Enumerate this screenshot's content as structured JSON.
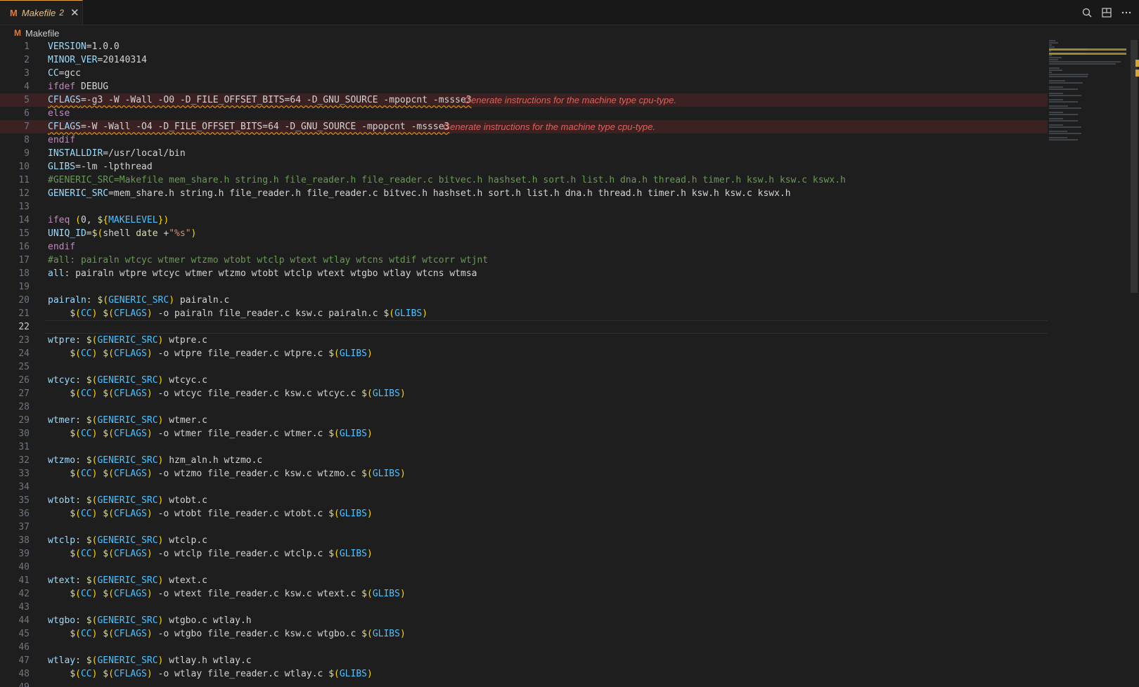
{
  "tab": {
    "icon": "M",
    "name": "Makefile",
    "problems": "2",
    "close_glyph": "✕"
  },
  "actions": [
    "search-icon",
    "split-editor-icon",
    "more-icon"
  ],
  "breadcrumb": {
    "icon": "M",
    "file": "Makefile"
  },
  "colors": {
    "keyword": "#c586c0",
    "variable": "#9cdcfe",
    "dollar": "#dcdcaa",
    "paren": "#ffd700",
    "comment": "#6a9955",
    "string": "#ce9178",
    "directive": "#c586c0",
    "error": "#e0625a",
    "active_tab_border": "#e2a33a"
  },
  "diagnostics": {
    "line5": "Generate instructions for the machine type cpu-type.",
    "line7": "Generate instructions for the machine type cpu-type."
  },
  "lines": [
    {
      "n": "1",
      "h": "<span class='v'>VERSION</span>=1.0.0"
    },
    {
      "n": "2",
      "h": "<span class='v'>MINOR_VER</span>=20140314"
    },
    {
      "n": "3",
      "h": "<span class='v'>CC</span>=gcc"
    },
    {
      "n": "4",
      "h": "<span class='k'>ifdef</span> DEBUG"
    },
    {
      "n": "5",
      "h": "<span class='v'>CFLAGS</span>=-g3 -W -Wall -O0 -D_FILE_OFFSET_BITS=64 -D_GNU_SOURCE -mpopcnt -mssse3",
      "err": "line5"
    },
    {
      "n": "6",
      "h": "<span class='k'>else</span>"
    },
    {
      "n": "7",
      "h": "<span class='v'>CFLAGS</span>=-W -Wall -O4 -D_FILE_OFFSET_BITS=64 -D_GNU_SOURCE -mpopcnt -mssse3",
      "err": "line7"
    },
    {
      "n": "8",
      "h": "<span class='k'>endif</span>"
    },
    {
      "n": "9",
      "h": "<span class='v'>INSTALLDIR</span>=/usr/local/bin"
    },
    {
      "n": "10",
      "h": "<span class='v'>GLIBS</span>=-lm -lpthread"
    },
    {
      "n": "11",
      "h": "<span class='c'>#GENERIC_SRC=Makefile mem_share.h string.h file_reader.h file_reader.c bitvec.h hashset.h sort.h list.h dna.h thread.h timer.h ksw.h ksw.c kswx.h</span>"
    },
    {
      "n": "12",
      "h": "<span class='v'>GENERIC_SRC</span>=mem_share.h string.h file_reader.h file_reader.c bitvec.h hashset.h sort.h list.h dna.h thread.h timer.h ksw.h ksw.c kswx.h"
    },
    {
      "n": "13",
      "h": ""
    },
    {
      "n": "14",
      "h": "<span class='k'>ifeq</span> <span class='p'>(</span>0, <span class='d'>$</span><span class='p'>{</span><span class='b'>MAKELEVEL</span><span class='p'>})</span>"
    },
    {
      "n": "15",
      "h": "<span class='v'>UNIQ_ID</span>=<span class='d'>$</span><span class='p'>(</span>shell <span class='y'>date</span> +<span class='s'>\"%s\"</span><span class='p'>)</span>"
    },
    {
      "n": "16",
      "h": "<span class='k'>endif</span>"
    },
    {
      "n": "17",
      "h": "<span class='c'>#all: pairaln wtcyc wtmer wtzmo wtobt wtclp wtext wtlay wtcns wtdif wtcorr wtjnt</span>"
    },
    {
      "n": "18",
      "h": "<span class='v'>all</span>: pairaln wtpre wtcyc wtmer wtzmo wtobt wtclp wtext wtgbo wtlay wtcns wtmsa"
    },
    {
      "n": "19",
      "h": ""
    },
    {
      "n": "20",
      "h": "<span class='v'>pairaln</span>: <span class='d'>$</span><span class='p'>(</span><span class='b'>GENERIC_SRC</span><span class='p'>)</span> pairaln.c"
    },
    {
      "n": "21",
      "h": "    <span class='d'>$</span><span class='p'>(</span><span class='b'>CC</span><span class='p'>)</span> <span class='d'>$</span><span class='p'>(</span><span class='b'>CFLAGS</span><span class='p'>)</span> -o pairaln file_reader.c ksw.c pairaln.c <span class='d'>$</span><span class='p'>(</span><span class='b'>GLIBS</span><span class='p'>)</span>"
    },
    {
      "n": "22",
      "h": "",
      "cur": true
    },
    {
      "n": "23",
      "h": "<span class='v'>wtpre</span>: <span class='d'>$</span><span class='p'>(</span><span class='b'>GENERIC_SRC</span><span class='p'>)</span> wtpre.c"
    },
    {
      "n": "24",
      "h": "    <span class='d'>$</span><span class='p'>(</span><span class='b'>CC</span><span class='p'>)</span> <span class='d'>$</span><span class='p'>(</span><span class='b'>CFLAGS</span><span class='p'>)</span> -o wtpre file_reader.c wtpre.c <span class='d'>$</span><span class='p'>(</span><span class='b'>GLIBS</span><span class='p'>)</span>"
    },
    {
      "n": "25",
      "h": ""
    },
    {
      "n": "26",
      "h": "<span class='v'>wtcyc</span>: <span class='d'>$</span><span class='p'>(</span><span class='b'>GENERIC_SRC</span><span class='p'>)</span> wtcyc.c"
    },
    {
      "n": "27",
      "h": "    <span class='d'>$</span><span class='p'>(</span><span class='b'>CC</span><span class='p'>)</span> <span class='d'>$</span><span class='p'>(</span><span class='b'>CFLAGS</span><span class='p'>)</span> -o wtcyc file_reader.c ksw.c wtcyc.c <span class='d'>$</span><span class='p'>(</span><span class='b'>GLIBS</span><span class='p'>)</span>"
    },
    {
      "n": "28",
      "h": ""
    },
    {
      "n": "29",
      "h": "<span class='v'>wtmer</span>: <span class='d'>$</span><span class='p'>(</span><span class='b'>GENERIC_SRC</span><span class='p'>)</span> wtmer.c"
    },
    {
      "n": "30",
      "h": "    <span class='d'>$</span><span class='p'>(</span><span class='b'>CC</span><span class='p'>)</span> <span class='d'>$</span><span class='p'>(</span><span class='b'>CFLAGS</span><span class='p'>)</span> -o wtmer file_reader.c wtmer.c <span class='d'>$</span><span class='p'>(</span><span class='b'>GLIBS</span><span class='p'>)</span>"
    },
    {
      "n": "31",
      "h": ""
    },
    {
      "n": "32",
      "h": "<span class='v'>wtzmo</span>: <span class='d'>$</span><span class='p'>(</span><span class='b'>GENERIC_SRC</span><span class='p'>)</span> hzm_aln.h wtzmo.c"
    },
    {
      "n": "33",
      "h": "    <span class='d'>$</span><span class='p'>(</span><span class='b'>CC</span><span class='p'>)</span> <span class='d'>$</span><span class='p'>(</span><span class='b'>CFLAGS</span><span class='p'>)</span> -o wtzmo file_reader.c ksw.c wtzmo.c <span class='d'>$</span><span class='p'>(</span><span class='b'>GLIBS</span><span class='p'>)</span>"
    },
    {
      "n": "34",
      "h": ""
    },
    {
      "n": "35",
      "h": "<span class='v'>wtobt</span>: <span class='d'>$</span><span class='p'>(</span><span class='b'>GENERIC_SRC</span><span class='p'>)</span> wtobt.c"
    },
    {
      "n": "36",
      "h": "    <span class='d'>$</span><span class='p'>(</span><span class='b'>CC</span><span class='p'>)</span> <span class='d'>$</span><span class='p'>(</span><span class='b'>CFLAGS</span><span class='p'>)</span> -o wtobt file_reader.c wtobt.c <span class='d'>$</span><span class='p'>(</span><span class='b'>GLIBS</span><span class='p'>)</span>"
    },
    {
      "n": "37",
      "h": ""
    },
    {
      "n": "38",
      "h": "<span class='v'>wtclp</span>: <span class='d'>$</span><span class='p'>(</span><span class='b'>GENERIC_SRC</span><span class='p'>)</span> wtclp.c"
    },
    {
      "n": "39",
      "h": "    <span class='d'>$</span><span class='p'>(</span><span class='b'>CC</span><span class='p'>)</span> <span class='d'>$</span><span class='p'>(</span><span class='b'>CFLAGS</span><span class='p'>)</span> -o wtclp file_reader.c wtclp.c <span class='d'>$</span><span class='p'>(</span><span class='b'>GLIBS</span><span class='p'>)</span>"
    },
    {
      "n": "40",
      "h": ""
    },
    {
      "n": "41",
      "h": "<span class='v'>wtext</span>: <span class='d'>$</span><span class='p'>(</span><span class='b'>GENERIC_SRC</span><span class='p'>)</span> wtext.c"
    },
    {
      "n": "42",
      "h": "    <span class='d'>$</span><span class='p'>(</span><span class='b'>CC</span><span class='p'>)</span> <span class='d'>$</span><span class='p'>(</span><span class='b'>CFLAGS</span><span class='p'>)</span> -o wtext file_reader.c ksw.c wtext.c <span class='d'>$</span><span class='p'>(</span><span class='b'>GLIBS</span><span class='p'>)</span>"
    },
    {
      "n": "43",
      "h": ""
    },
    {
      "n": "44",
      "h": "<span class='v'>wtgbo</span>: <span class='d'>$</span><span class='p'>(</span><span class='b'>GENERIC_SRC</span><span class='p'>)</span> wtgbo.c wtlay.h"
    },
    {
      "n": "45",
      "h": "    <span class='d'>$</span><span class='p'>(</span><span class='b'>CC</span><span class='p'>)</span> <span class='d'>$</span><span class='p'>(</span><span class='b'>CFLAGS</span><span class='p'>)</span> -o wtgbo file_reader.c ksw.c wtgbo.c <span class='d'>$</span><span class='p'>(</span><span class='b'>GLIBS</span><span class='p'>)</span>"
    },
    {
      "n": "46",
      "h": ""
    },
    {
      "n": "47",
      "h": "<span class='v'>wtlay</span>: <span class='d'>$</span><span class='p'>(</span><span class='b'>GENERIC_SRC</span><span class='p'>)</span> wtlay.h wtlay.c"
    },
    {
      "n": "48",
      "h": "    <span class='d'>$</span><span class='p'>(</span><span class='b'>CC</span><span class='p'>)</span> <span class='d'>$</span><span class='p'>(</span><span class='b'>CFLAGS</span><span class='p'>)</span> -o wtlay file_reader.c wtlay.c <span class='d'>$</span><span class='p'>(</span><span class='b'>GLIBS</span><span class='p'>)</span>"
    },
    {
      "n": "49",
      "h": ""
    }
  ]
}
